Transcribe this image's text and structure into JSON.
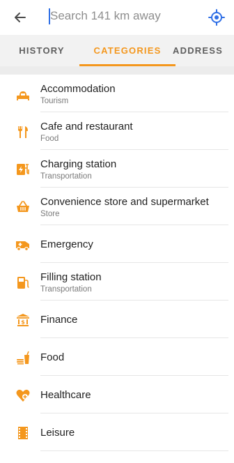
{
  "search": {
    "placeholder": "Search 141 km away"
  },
  "tabs": [
    {
      "label": "HISTORY",
      "active": false
    },
    {
      "label": "CATEGORIES",
      "active": true
    },
    {
      "label": "ADDRESS",
      "active": false
    }
  ],
  "accent_color": "#f4971d",
  "categories": [
    {
      "title": "Accommodation",
      "subtitle": "Tourism",
      "icon": "bed-icon"
    },
    {
      "title": "Cafe and restaurant",
      "subtitle": "Food",
      "icon": "fork-knife-icon"
    },
    {
      "title": "Charging station",
      "subtitle": "Transportation",
      "icon": "charging-plug-icon"
    },
    {
      "title": "Convenience store and supermarket",
      "subtitle": "Store",
      "icon": "basket-icon"
    },
    {
      "title": "Emergency",
      "subtitle": "",
      "icon": "ambulance-icon"
    },
    {
      "title": "Filling station",
      "subtitle": "Transportation",
      "icon": "fuel-pump-icon"
    },
    {
      "title": "Finance",
      "subtitle": "",
      "icon": "bank-icon"
    },
    {
      "title": "Food",
      "subtitle": "",
      "icon": "food-drink-icon"
    },
    {
      "title": "Healthcare",
      "subtitle": "",
      "icon": "heart-plus-icon"
    },
    {
      "title": "Leisure",
      "subtitle": "",
      "icon": "film-icon"
    }
  ]
}
